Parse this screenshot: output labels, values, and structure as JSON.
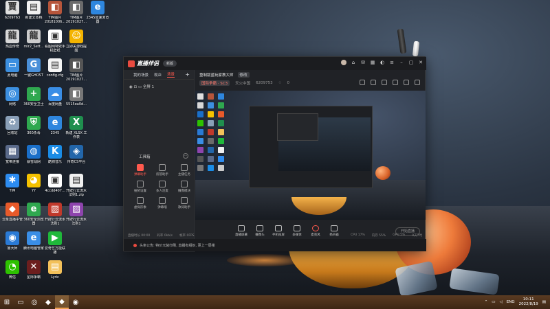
{
  "desktop": {
    "icons": [
      {
        "label": "6209763",
        "glyph": "賈",
        "color": "#e0e0e0",
        "col": 0,
        "row": 0
      },
      {
        "label": "新建文本档",
        "glyph": "▤",
        "color": "#f1f1f1",
        "col": 1,
        "row": 0
      },
      {
        "label": "TIM图片20181006...",
        "glyph": "◧",
        "color": "#b6553b",
        "col": 2,
        "row": 0
      },
      {
        "label": "TIM图片20191027...",
        "glyph": "◧",
        "color": "#6b6b6b",
        "col": 3,
        "row": 0
      },
      {
        "label": "2345加速浏览器",
        "glyph": "e",
        "color": "#2e86de",
        "col": 4,
        "row": 0
      },
      {
        "label": "热血传奇",
        "glyph": "龍",
        "color": "#d8d8d8",
        "col": 0,
        "row": 1
      },
      {
        "label": "mir2_Sett...",
        "glyph": "龍",
        "color": "#cccccc",
        "col": 1,
        "row": 1
      },
      {
        "label": "看图网特效手机壁纸nnssie...",
        "glyph": "▣",
        "color": "#ffffff",
        "col": 2,
        "row": 1
      },
      {
        "label": "立即关游戏提醒",
        "glyph": "☺",
        "color": "#f4b400",
        "col": 3,
        "row": 1
      },
      {
        "label": "此电脑",
        "glyph": "▭",
        "color": "#3c8fe0",
        "col": 0,
        "row": 2
      },
      {
        "label": "一键GHOST",
        "glyph": "G",
        "color": "#4a90d9",
        "col": 1,
        "row": 2
      },
      {
        "label": "config.cfg",
        "glyph": "▤",
        "color": "#f5f5f5",
        "col": 2,
        "row": 2
      },
      {
        "label": "TIM图片20191027...",
        "glyph": "◧",
        "color": "#555555",
        "col": 3,
        "row": 2
      },
      {
        "label": "网络",
        "glyph": "◎",
        "color": "#3c8fe0",
        "col": 0,
        "row": 3
      },
      {
        "label": "360安全卫士",
        "glyph": "+",
        "color": "#2fa84f",
        "col": 1,
        "row": 3
      },
      {
        "label": "百度网盘",
        "glyph": "☁",
        "color": "#3a8ee6",
        "col": 2,
        "row": 3
      },
      {
        "label": "5515ea0d...",
        "glyph": "◧",
        "color": "#777777",
        "col": 3,
        "row": 3
      },
      {
        "label": "回收站",
        "glyph": "♻",
        "color": "#8aa0b8",
        "col": 0,
        "row": 4
      },
      {
        "label": "360杀毒",
        "glyph": "⛨",
        "color": "#2fa84f",
        "col": 1,
        "row": 4
      },
      {
        "label": "2345",
        "glyph": "e",
        "color": "#2e86de",
        "col": 2,
        "row": 4
      },
      {
        "label": "新建 XLSX 工作表",
        "glyph": "X",
        "color": "#1f8f4e",
        "col": 3,
        "row": 4
      },
      {
        "label": "宽带连接",
        "glyph": "▦",
        "color": "#5a6a8a",
        "col": 0,
        "row": 5
      },
      {
        "label": "暴雪战网",
        "glyph": "◍",
        "color": "#1a6fc9",
        "col": 1,
        "row": 5
      },
      {
        "label": "酷狗音乐",
        "glyph": "K",
        "color": "#1a8ce6",
        "col": 2,
        "row": 5
      },
      {
        "label": "传奇CS平台",
        "glyph": "◈",
        "color": "#2266aa",
        "col": 3,
        "row": 5
      },
      {
        "label": "TIM",
        "glyph": "✱",
        "color": "#2d8cf0",
        "col": 0,
        "row": 6
      },
      {
        "label": "YY",
        "glyph": "◕",
        "color": "#f5c200",
        "col": 1,
        "row": 6
      },
      {
        "label": "4ccdd407...",
        "glyph": "▣",
        "color": "#ffffff",
        "col": 2,
        "row": 6
      },
      {
        "label": "开辟行云流水法则1.zip",
        "glyph": "▤",
        "color": "#f0f0f0",
        "col": 3,
        "row": 6
      },
      {
        "label": "云象直播中管",
        "glyph": "◆",
        "color": "#e85a2a",
        "col": 0,
        "row": 7
      },
      {
        "label": "360安全浏览器",
        "glyph": "e",
        "color": "#2fa84f",
        "col": 1,
        "row": 7
      },
      {
        "label": "开辟行云流水法则1",
        "glyph": "▨",
        "color": "#c0392b",
        "col": 2,
        "row": 7
      },
      {
        "label": "开辟行云流水法则1",
        "glyph": "▨",
        "color": "#8e44ad",
        "col": 3,
        "row": 7
      },
      {
        "label": "鲁大师",
        "glyph": "◉",
        "color": "#2a7ad5",
        "col": 0,
        "row": 8
      },
      {
        "label": "腾讯电脑管家",
        "glyph": "e",
        "color": "#3a8ee6",
        "col": 1,
        "row": 8
      },
      {
        "label": "爱奇艺万能联播",
        "glyph": "▶",
        "color": "#1fb83a",
        "col": 2,
        "row": 8
      },
      {
        "label": "微信",
        "glyph": "◔",
        "color": "#2dc100",
        "col": 0,
        "row": 9
      },
      {
        "label": "星际争霸",
        "glyph": "✕",
        "color": "#6c1e1e",
        "col": 1,
        "row": 9
      },
      {
        "label": "Lyric",
        "glyph": "▤",
        "color": "#f3c15a",
        "col": 2,
        "row": 9
      }
    ]
  },
  "app": {
    "logo_text": "直播伴侣",
    "version_badge": "新版",
    "tabs": [
      "我的场景",
      "观众",
      "场景"
    ],
    "active_tab_index": 2,
    "scene_label": "全屏 1",
    "tools_title": "工具箱",
    "tools": [
      {
        "label": "弹幕助手",
        "hot": true
      },
      {
        "label": "房管助手",
        "hot": false
      },
      {
        "label": "主播任务",
        "hot": false
      },
      {
        "label": "抽奖设置",
        "hot": false
      },
      {
        "label": "多人连麦",
        "hot": false
      },
      {
        "label": "摄像模块",
        "hot": false
      },
      {
        "label": "虚拟形象",
        "hot": false
      },
      {
        "label": "弹幕墙",
        "hot": false
      },
      {
        "label": "歌词助手",
        "hot": false
      }
    ],
    "stream": {
      "title": "重制版蓝玩家教大师",
      "title_tag": "修改",
      "category_tag": "国际争霸 · SC3",
      "room_label": "天火中国",
      "room_id": "6209753",
      "likes": "0"
    },
    "controls": [
      {
        "label": "直播屏幕",
        "name": "screen-capture"
      },
      {
        "label": "摄像头",
        "name": "camera"
      },
      {
        "label": "手机投屏",
        "name": "phone-cast"
      },
      {
        "label": "多媒体",
        "name": "media"
      },
      {
        "label": "麦克风",
        "name": "mic"
      },
      {
        "label": "扬声器",
        "name": "speaker"
      }
    ],
    "go_live_label": "开始直播",
    "status": {
      "left": [
        "直播时长 00:00",
        "码率 0kb/s",
        "帧率 0FPS"
      ],
      "right": [
        "CPU 17%",
        "内存 55%",
        "GPU 5%",
        "0天7时"
      ]
    },
    "notice": "头条公告: 特价元装印刷, 直播有组织, 更上一层楼"
  },
  "taskbar": {
    "start_glyph": "⊞",
    "buttons": [
      "▭",
      "◎",
      "◆",
      "◆",
      "◉"
    ],
    "active_index": 3,
    "tray": {
      "ime": "ENG",
      "time": "10:11",
      "date": "2022/8/19"
    }
  }
}
